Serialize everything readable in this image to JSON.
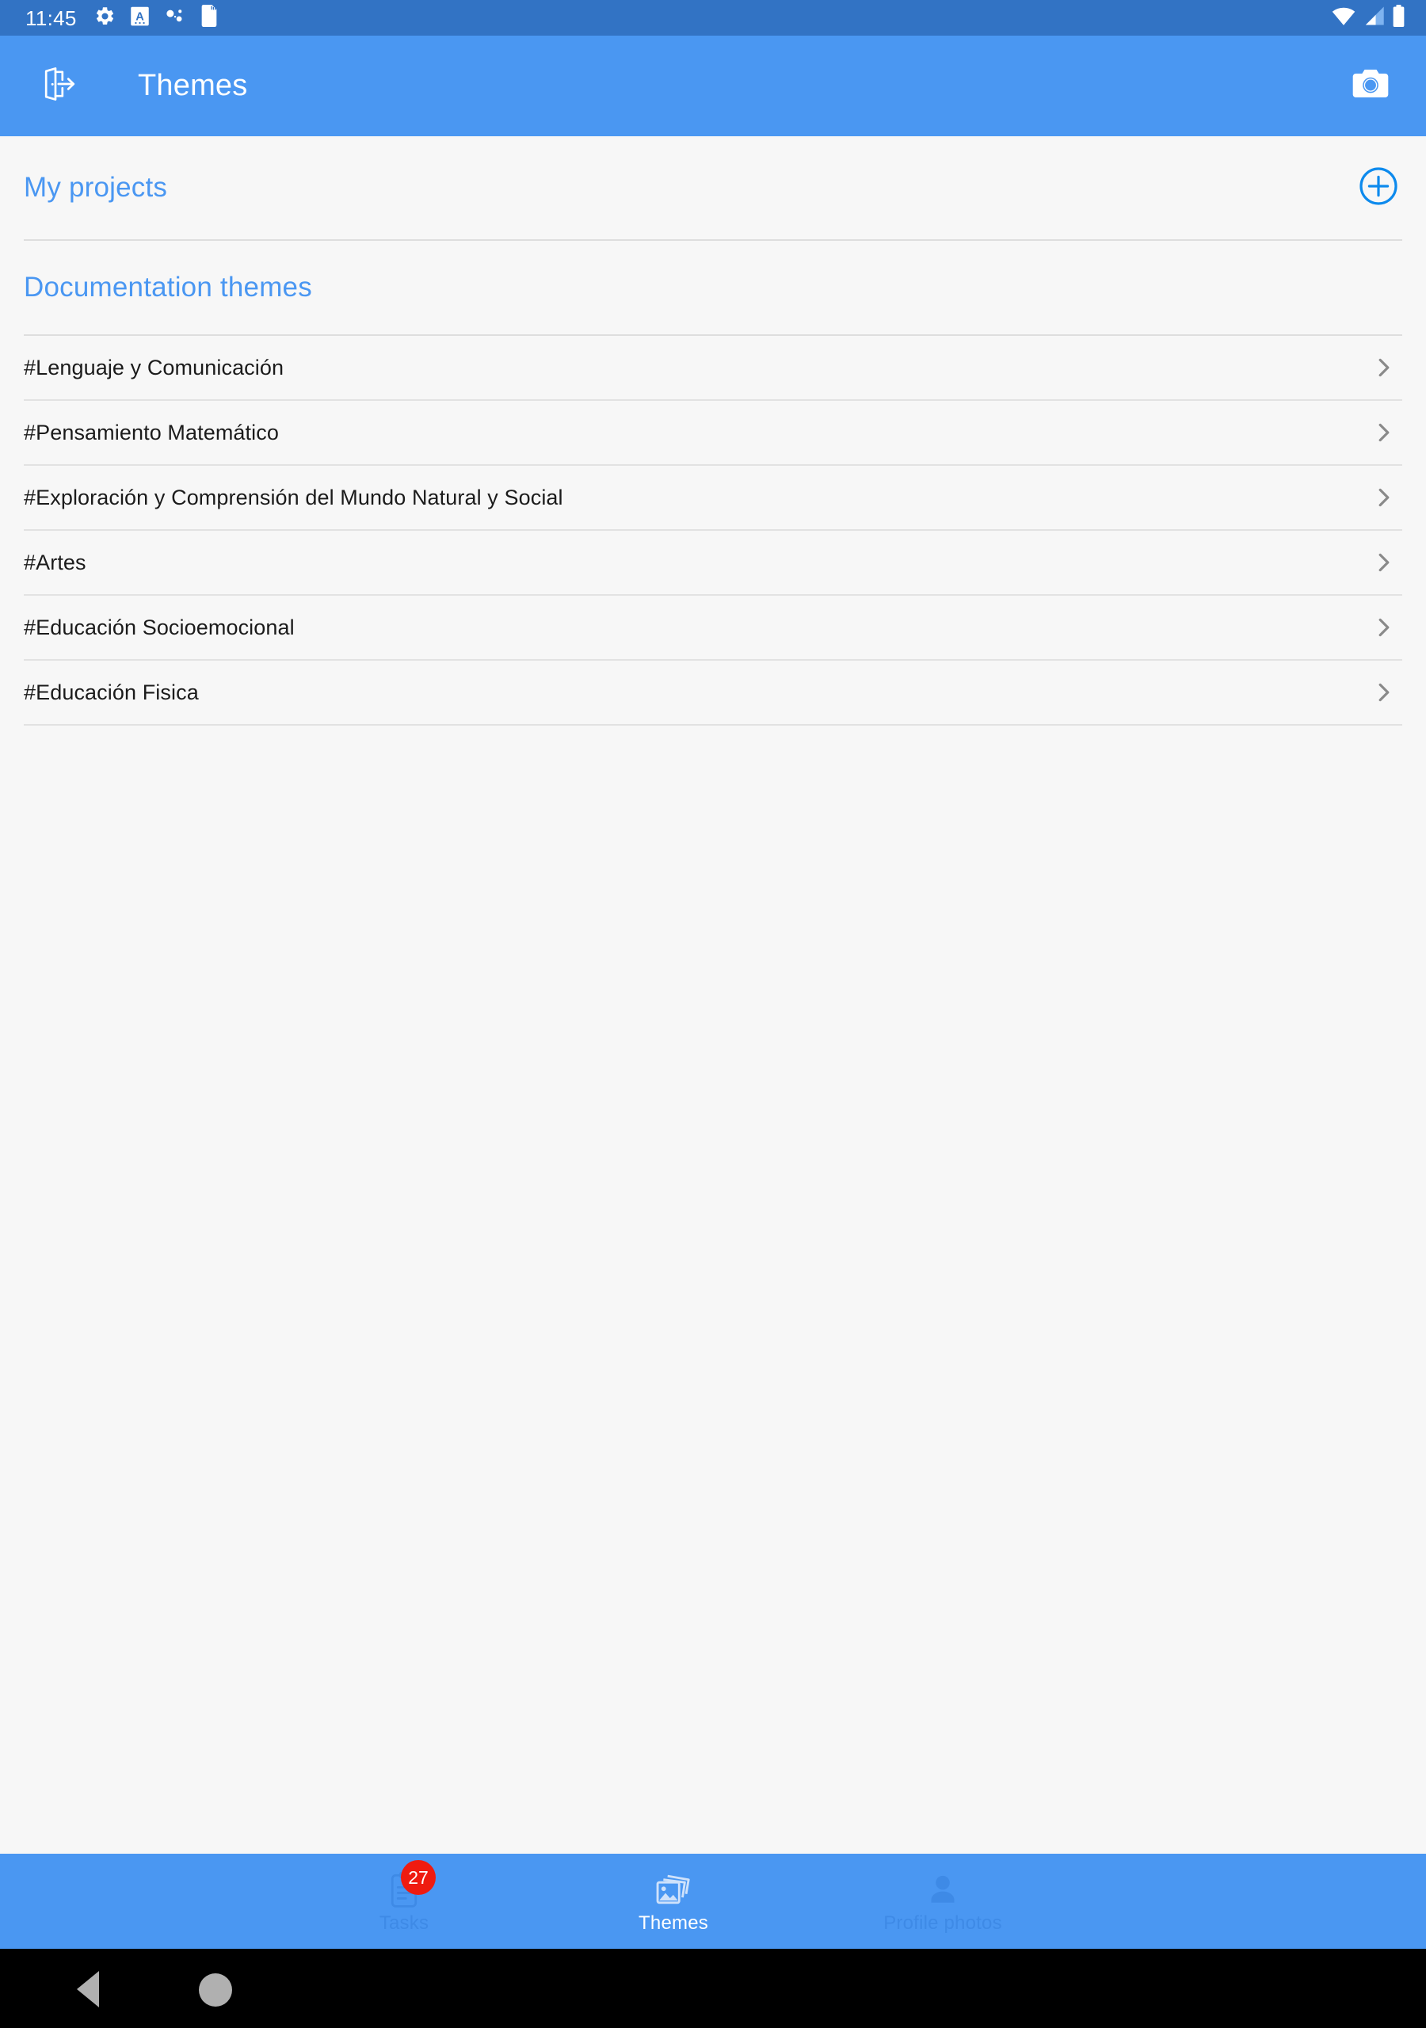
{
  "status_bar": {
    "clock": "11:45",
    "left_icons": [
      "gear-icon",
      "android-a-icon",
      "bluetooth-dots-icon",
      "sd-card-icon"
    ],
    "right_icons": [
      "wifi-icon",
      "cellular-signal-icon",
      "battery-icon"
    ],
    "background": "#3273c4"
  },
  "app_bar": {
    "nav_icon": "exit-door-icon",
    "title": "Themes",
    "action_icon": "camera-icon",
    "background": "#4a97f2"
  },
  "colors": {
    "accent": "#4a97f2",
    "add_button": "#0d8aed",
    "badge": "#ef1b10",
    "divider": "#dedede",
    "page_background": "#f7f7f7",
    "text": "#1b1b1b"
  },
  "sections": {
    "my_projects": {
      "title": "My projects",
      "add_icon": "plus-circle-icon"
    },
    "documentation_themes": {
      "title": "Documentation themes",
      "items": [
        {
          "label": "#Lenguaje y Comunicación",
          "chevron": "chevron-right-icon"
        },
        {
          "label": "#Pensamiento Matemático",
          "chevron": "chevron-right-icon"
        },
        {
          "label": "#Exploración y Comprensión del Mundo Natural y Social",
          "chevron": "chevron-right-icon"
        },
        {
          "label": "#Artes",
          "chevron": "chevron-right-icon"
        },
        {
          "label": "#Educación Socioemocional",
          "chevron": "chevron-right-icon"
        },
        {
          "label": "#Educación Fisica",
          "chevron": "chevron-right-icon"
        }
      ]
    }
  },
  "bottom_nav": {
    "items": [
      {
        "label": "Tasks",
        "icon": "clipboard-icon",
        "badge": "27",
        "active": false
      },
      {
        "label": "Themes",
        "icon": "photos-icon",
        "badge": "",
        "active": true
      },
      {
        "label": "Profile photos",
        "icon": "person-icon",
        "badge": "",
        "active": false
      }
    ]
  },
  "system_nav": {
    "back": "back-triangle-icon",
    "home": "home-circle-icon"
  }
}
